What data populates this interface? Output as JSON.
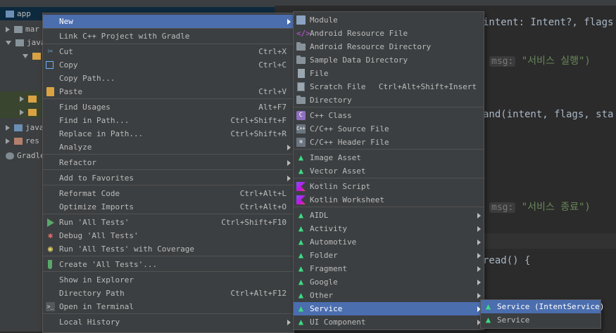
{
  "project_tree": {
    "rows": [
      "app",
      "mar",
      "java",
      "",
      "",
      "",
      "java",
      "res",
      "Gradle"
    ]
  },
  "editor": {
    "line1_code": "intent: Intent?, flags",
    "line2_hint": "msg:",
    "line2_str": "\"서비스 실행\")",
    "line3_code": "and(intent, flags, sta",
    "line4_hint": "msg:",
    "line4_str": "\"서비스 종료\")",
    "line5_code": "read() {"
  },
  "context_menu": {
    "items": [
      {
        "label": "New",
        "shortcut": "",
        "submenu": true,
        "icon": "",
        "selected": true
      },
      {
        "label": "Link C++ Project with Gradle",
        "shortcut": "",
        "submenu": false,
        "icon": ""
      },
      {
        "label": "Cut",
        "shortcut": "Ctrl+X",
        "submenu": false,
        "icon": "scissors-icon"
      },
      {
        "label": "Copy",
        "shortcut": "Ctrl+C",
        "submenu": false,
        "icon": "copy-icon"
      },
      {
        "label": "Copy Path...",
        "shortcut": "",
        "submenu": false,
        "icon": ""
      },
      {
        "label": "Paste",
        "shortcut": "Ctrl+V",
        "submenu": false,
        "icon": "clipboard-icon"
      },
      {
        "label": "Find Usages",
        "shortcut": "Alt+F7",
        "submenu": false,
        "icon": ""
      },
      {
        "label": "Find in Path...",
        "shortcut": "Ctrl+Shift+F",
        "submenu": false,
        "icon": ""
      },
      {
        "label": "Replace in Path...",
        "shortcut": "Ctrl+Shift+R",
        "submenu": false,
        "icon": ""
      },
      {
        "label": "Analyze",
        "shortcut": "",
        "submenu": true,
        "icon": ""
      },
      {
        "label": "Refactor",
        "shortcut": "",
        "submenu": true,
        "icon": ""
      },
      {
        "label": "Add to Favorites",
        "shortcut": "",
        "submenu": true,
        "icon": ""
      },
      {
        "label": "Reformat Code",
        "shortcut": "Ctrl+Alt+L",
        "submenu": false,
        "icon": ""
      },
      {
        "label": "Optimize Imports",
        "shortcut": "Ctrl+Alt+O",
        "submenu": false,
        "icon": ""
      },
      {
        "label": "Run 'All Tests'",
        "shortcut": "Ctrl+Shift+F10",
        "submenu": false,
        "icon": "run-icon"
      },
      {
        "label": "Debug 'All Tests'",
        "shortcut": "",
        "submenu": false,
        "icon": "debug-icon"
      },
      {
        "label": "Run 'All Tests' with Coverage",
        "shortcut": "",
        "submenu": false,
        "icon": "coverage-icon"
      },
      {
        "label": "Create 'All Tests'...",
        "shortcut": "",
        "submenu": false,
        "icon": "test-tube-icon"
      },
      {
        "label": "Show in Explorer",
        "shortcut": "",
        "submenu": false,
        "icon": ""
      },
      {
        "label": "Directory Path",
        "shortcut": "Ctrl+Alt+F12",
        "submenu": false,
        "icon": ""
      },
      {
        "label": "Open in Terminal",
        "shortcut": "",
        "submenu": false,
        "icon": "terminal-icon"
      },
      {
        "label": "Local History",
        "shortcut": "",
        "submenu": true,
        "icon": ""
      }
    ]
  },
  "new_submenu": {
    "items": [
      {
        "label": "Module",
        "shortcut": "",
        "submenu": false,
        "icon": "module-icon"
      },
      {
        "label": "Android Resource File",
        "shortcut": "",
        "submenu": false,
        "icon": "android-resource-icon"
      },
      {
        "label": "Android Resource Directory",
        "shortcut": "",
        "submenu": false,
        "icon": "folder-icon"
      },
      {
        "label": "Sample Data Directory",
        "shortcut": "",
        "submenu": false,
        "icon": "folder-icon"
      },
      {
        "label": "File",
        "shortcut": "",
        "submenu": false,
        "icon": "file-icon"
      },
      {
        "label": "Scratch File",
        "shortcut": "Ctrl+Alt+Shift+Insert",
        "submenu": false,
        "icon": "scratch-file-icon"
      },
      {
        "label": "Directory",
        "shortcut": "",
        "submenu": false,
        "icon": "folder-icon"
      },
      {
        "label": "C++ Class",
        "shortcut": "",
        "submenu": false,
        "icon": "cpp-class-icon"
      },
      {
        "label": "C/C++ Source File",
        "shortcut": "",
        "submenu": false,
        "icon": "cpp-source-icon"
      },
      {
        "label": "C/C++ Header File",
        "shortcut": "",
        "submenu": false,
        "icon": "cpp-header-icon"
      },
      {
        "label": "Image Asset",
        "shortcut": "",
        "submenu": false,
        "icon": "android-icon"
      },
      {
        "label": "Vector Asset",
        "shortcut": "",
        "submenu": false,
        "icon": "android-icon"
      },
      {
        "label": "Kotlin Script",
        "shortcut": "",
        "submenu": false,
        "icon": "kotlin-icon"
      },
      {
        "label": "Kotlin Worksheet",
        "shortcut": "",
        "submenu": false,
        "icon": "kotlin-icon"
      },
      {
        "label": "AIDL",
        "shortcut": "",
        "submenu": true,
        "icon": "android-icon"
      },
      {
        "label": "Activity",
        "shortcut": "",
        "submenu": true,
        "icon": "android-icon"
      },
      {
        "label": "Automotive",
        "shortcut": "",
        "submenu": true,
        "icon": "android-icon"
      },
      {
        "label": "Folder",
        "shortcut": "",
        "submenu": true,
        "icon": "android-icon"
      },
      {
        "label": "Fragment",
        "shortcut": "",
        "submenu": true,
        "icon": "android-icon"
      },
      {
        "label": "Google",
        "shortcut": "",
        "submenu": true,
        "icon": "android-icon"
      },
      {
        "label": "Other",
        "shortcut": "",
        "submenu": true,
        "icon": "android-icon"
      },
      {
        "label": "Service",
        "shortcut": "",
        "submenu": true,
        "icon": "android-icon",
        "selected": true
      },
      {
        "label": "UI Component",
        "shortcut": "",
        "submenu": true,
        "icon": "android-icon"
      }
    ]
  },
  "service_submenu": {
    "items": [
      {
        "label": "Service (IntentService)",
        "shortcut": "",
        "submenu": false,
        "icon": "android-icon",
        "selected": true
      },
      {
        "label": "Service",
        "shortcut": "",
        "submenu": false,
        "icon": "android-icon"
      }
    ]
  },
  "colors": {
    "menu_bg": "#3c3f41",
    "selection": "#4b6eaf",
    "editor_bg": "#2b2b2b",
    "string": "#6a8759",
    "android_green": "#3ddc84"
  }
}
